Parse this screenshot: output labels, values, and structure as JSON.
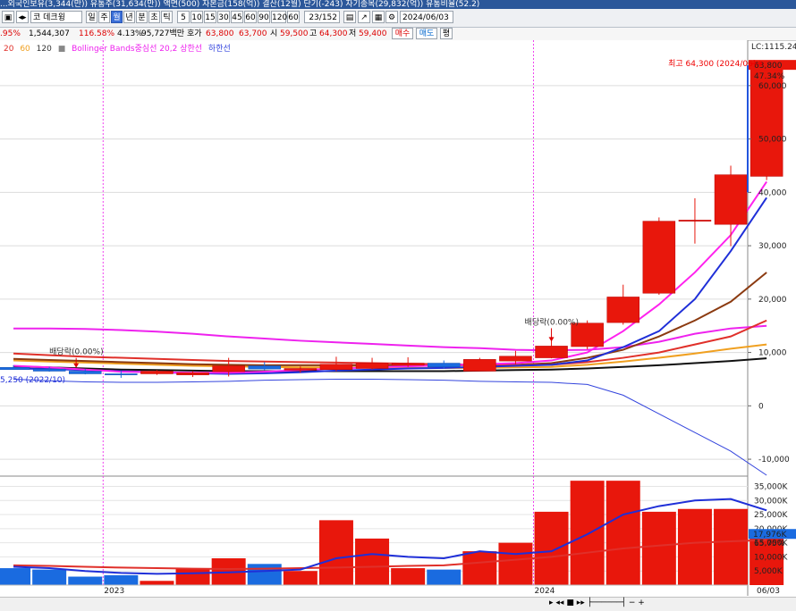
{
  "titlebar": {
    "text": "...외국인보유(3,344(만)) 유통주(31,634(만)) 액면(500) 자본금(158(억)) 결산(12월) 단기(-243) 자기종목(29,832(억)) 유통비율(52.2)"
  },
  "toolbar": {
    "stock_name": "코 데크윙",
    "period_buttons": [
      "일",
      "주",
      "월",
      "년",
      "분",
      "초",
      "틱"
    ],
    "selected_period": "월",
    "minute_buttons": [
      "5",
      "10",
      "15",
      "30",
      "45",
      "60",
      "90",
      "120",
      "60"
    ],
    "count_value": "23",
    "count_total": "/152",
    "date_value": "2024/06/03"
  },
  "infobar": {
    "change_pct": ".95%",
    "volume": "1,544,307",
    "volume_ratio": "116.58%",
    "turnover": "4.13%",
    "amount": "95,727백만",
    "hoga_label": "호가",
    "hoga_sell": "63,800",
    "hoga_buy": "63,700",
    "open_label": "시",
    "open": "59,500",
    "high_label": "고",
    "high": "64,300",
    "low_label": "저",
    "low": "59,400",
    "buy_btn": "매수",
    "sell_btn": "매도",
    "eval_btn": "평"
  },
  "legend": {
    "ma20": "20",
    "ma60": "60",
    "ma120": "120",
    "bollinger": "Bollinger Bands중심선 20,2 상한선",
    "lower": "하한선",
    "colors": {
      "ma20": "#e0302a",
      "ma60": "#f0a020",
      "ma120": "#333333",
      "bollinger": "#ee22ee",
      "lower": "#3344dd"
    }
  },
  "annotations": {
    "high_label": "최고 64,300 (2024/06)",
    "dividend1": "배당락(0.00%)",
    "dividend2": "배당락(0.00%)",
    "low_label": "5,250 (2022/10)"
  },
  "right_axis": {
    "lc_label": "LC:1115.24",
    "price_tag": "63,800",
    "pct_tag": "47.34%",
    "price_ticks": [
      "60,000",
      "50,000",
      "40,000",
      "30,000",
      "20,000",
      "10,000",
      "0",
      "-10,000"
    ],
    "volume_tag": "17,976K",
    "volume_pct": "65.75%",
    "volume_ticks": [
      "35,000K",
      "30,000K",
      "25,000K",
      "20,000K",
      "15,000K",
      "10,000K",
      "5,000K"
    ],
    "date_tag": "06/03"
  },
  "x_axis": {
    "labels": [
      "2023",
      "2024"
    ]
  },
  "chart_data": {
    "type": "candlestick",
    "price_ylim": [
      -13000,
      66000
    ],
    "volume_ylim": [
      0,
      38000
    ],
    "candles": [
      {
        "open": 7200,
        "high": 7600,
        "low": 6800,
        "close": 6800,
        "vol": 6000
      },
      {
        "open": 6900,
        "high": 7300,
        "low": 6400,
        "close": 6500,
        "vol": 5500
      },
      {
        "open": 6500,
        "high": 6900,
        "low": 5900,
        "close": 6000,
        "vol": 3000
      },
      {
        "open": 6000,
        "high": 6600,
        "low": 5250,
        "close": 5800,
        "vol": 3500
      },
      {
        "open": 6000,
        "high": 6700,
        "low": 5800,
        "close": 6500,
        "vol": 1500
      },
      {
        "open": 5800,
        "high": 6500,
        "low": 5400,
        "close": 6200,
        "vol": 6000
      },
      {
        "open": 6400,
        "high": 9000,
        "low": 5500,
        "close": 7500,
        "vol": 9500
      },
      {
        "open": 7500,
        "high": 8200,
        "low": 6700,
        "close": 6900,
        "vol": 7500
      },
      {
        "open": 6700,
        "high": 7400,
        "low": 6200,
        "close": 7000,
        "vol": 5000
      },
      {
        "open": 6800,
        "high": 9200,
        "low": 6500,
        "close": 7800,
        "vol": 23000
      },
      {
        "open": 7000,
        "high": 9000,
        "low": 6800,
        "close": 8000,
        "vol": 16500
      },
      {
        "open": 7600,
        "high": 9100,
        "low": 7300,
        "close": 8000,
        "vol": 6000
      },
      {
        "open": 8000,
        "high": 8500,
        "low": 7000,
        "close": 7300,
        "vol": 5500
      },
      {
        "open": 6500,
        "high": 9000,
        "low": 6500,
        "close": 8700,
        "vol": 12000
      },
      {
        "open": 8400,
        "high": 10300,
        "low": 7800,
        "close": 9300,
        "vol": 15000
      },
      {
        "open": 9000,
        "high": 12300,
        "low": 8900,
        "close": 11200,
        "vol": 26000
      },
      {
        "open": 11100,
        "high": 16000,
        "low": 10600,
        "close": 15500,
        "vol": 37000
      },
      {
        "open": 15600,
        "high": 22700,
        "low": 15200,
        "close": 20400,
        "vol": 37000
      },
      {
        "open": 21100,
        "high": 35300,
        "low": 20800,
        "close": 34600,
        "vol": 26000
      },
      {
        "open": 34600,
        "high": 38900,
        "low": 30400,
        "close": 34800,
        "vol": 27000
      },
      {
        "open": 34000,
        "high": 45000,
        "low": 29900,
        "close": 43300,
        "vol": 27000
      },
      {
        "open": 43000,
        "high": 64300,
        "low": 42300,
        "close": 63800,
        "vol": 17976
      }
    ],
    "volume_ma_blue": [
      6500,
      6000,
      5000,
      4300,
      4000,
      4200,
      4500,
      5000,
      5500,
      9500,
      11000,
      10000,
      9500,
      12000,
      11000,
      12000,
      18000,
      25000,
      28000,
      30000,
      30500,
      26500
    ],
    "volume_ma_red": [
      7000,
      6800,
      6500,
      6200,
      6000,
      5800,
      5700,
      5800,
      6000,
      6200,
      6500,
      6800,
      7000,
      8000,
      9000,
      10000,
      11500,
      13000,
      14000,
      15000,
      15500,
      16000
    ],
    "ma5_magenta": [
      7500,
      7200,
      6800,
      6400,
      6300,
      6200,
      6200,
      6400,
      6700,
      7000,
      7200,
      7400,
      7600,
      7800,
      8000,
      8500,
      10000,
      14000,
      19000,
      25000,
      32000,
      42000
    ],
    "ma10_blue": [
      7000,
      6900,
      6700,
      6500,
      6300,
      6100,
      6000,
      6100,
      6300,
      6600,
      6800,
      7000,
      7100,
      7300,
      7500,
      7700,
      8500,
      11000,
      14000,
      20000,
      29000,
      39000
    ],
    "ma20_red": [
      9800,
      9500,
      9200,
      9000,
      8800,
      8600,
      8400,
      8300,
      8200,
      8100,
      8000,
      7900,
      7800,
      7700,
      7600,
      7700,
      8200,
      9000,
      10000,
      11500,
      13000,
      16000
    ],
    "ma40_brown": [
      8800,
      8600,
      8400,
      8200,
      8000,
      7800,
      7700,
      7600,
      7600,
      7600,
      7600,
      7600,
      7600,
      7600,
      7700,
      8000,
      9000,
      10500,
      13000,
      16000,
      19500,
      25000
    ],
    "ma60_orange": [
      8500,
      8300,
      8100,
      7900,
      7700,
      7500,
      7400,
      7300,
      7200,
      7200,
      7200,
      7100,
      7100,
      7100,
      7200,
      7300,
      7700,
      8300,
      9000,
      9800,
      10700,
      11500
    ],
    "ma120_black": [
      7400,
      7200,
      7000,
      6800,
      6700,
      6600,
      6500,
      6500,
      6500,
      6500,
      6500,
      6500,
      6500,
      6600,
      6700,
      6800,
      7000,
      7300,
      7600,
      8000,
      8400,
      8900
    ],
    "bb_upper": [
      14500,
      14500,
      14400,
      14200,
      13900,
      13500,
      13000,
      12600,
      12200,
      11900,
      11600,
      11300,
      11000,
      10800,
      10500,
      10400,
      10500,
      11000,
      12000,
      13500,
      14500,
      15000
    ],
    "bb_lower": [
      5000,
      4700,
      4500,
      4400,
      4400,
      4500,
      4600,
      4800,
      4900,
      5000,
      5000,
      4900,
      4800,
      4600,
      4500,
      4400,
      4000,
      2000,
      -1500,
      -5000,
      -8500,
      -13000
    ],
    "dividend_marks": [
      1,
      15
    ],
    "year_marks": [
      {
        "idx": 2.5,
        "label": "2023"
      },
      {
        "idx": 14.5,
        "label": "2024"
      }
    ]
  }
}
